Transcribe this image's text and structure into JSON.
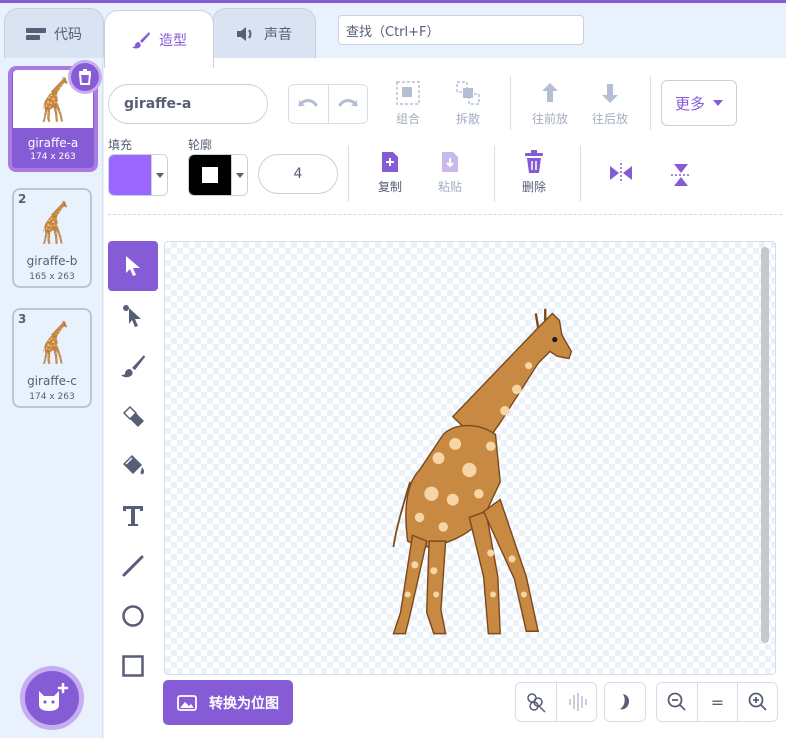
{
  "tabs": {
    "code": "代码",
    "costumes": "造型",
    "sounds": "声音"
  },
  "search": {
    "placeholder": "查找（Ctrl+F）"
  },
  "costumes": [
    {
      "num": "1",
      "name": "giraffe-a",
      "size": "174 x 263",
      "selected": true
    },
    {
      "num": "2",
      "name": "giraffe-b",
      "size": "165 x 263",
      "selected": false
    },
    {
      "num": "3",
      "name": "giraffe-c",
      "size": "174 x 263",
      "selected": false
    }
  ],
  "editor": {
    "costume_name": "giraffe-a",
    "group": "组合",
    "ungroup": "拆散",
    "forward": "往前放",
    "backward": "往后放",
    "more": "更多",
    "fill_label": "填充",
    "outline_label": "轮廓",
    "fill_color": "#9966ff",
    "outline_color": "#000000",
    "stroke_width": "4",
    "copy": "复制",
    "paste": "粘贴",
    "delete": "删除",
    "convert_bitmap": "转换为位图",
    "zoom_reset": "="
  },
  "colors": {
    "accent": "#855cd6",
    "accent_light": "#c6aef2",
    "text": "#575e75",
    "disabled": "#a3adc2"
  }
}
